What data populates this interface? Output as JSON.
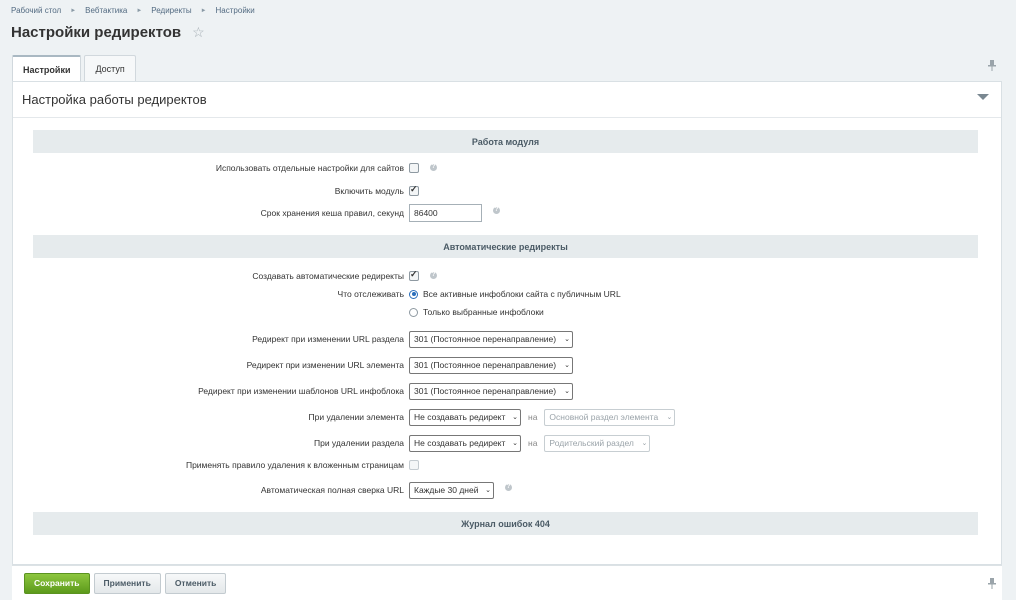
{
  "breadcrumbs": [
    "Рабочий стол",
    "Вебтактика",
    "Редиректы",
    "Настройки"
  ],
  "title": "Настройки редиректов",
  "tabs": [
    {
      "label": "Настройки",
      "active": true
    },
    {
      "label": "Доступ",
      "active": false
    }
  ],
  "panel_title": "Настройка работы редиректов",
  "sections": {
    "module": "Работа модуля",
    "auto": "Автоматические редиректы",
    "errors": "Журнал ошибок 404"
  },
  "fields": {
    "separate_sites": {
      "label": "Использовать отдельные настройки для сайтов",
      "checked": false
    },
    "enable_module": {
      "label": "Включить модуль",
      "checked": true
    },
    "cache_time": {
      "label": "Срок хранения кеша правил, секунд",
      "value": "86400"
    },
    "create_auto": {
      "label": "Создавать автоматические редиректы",
      "checked": true
    },
    "track": {
      "label": "Что отслеживать",
      "options": [
        "Все активные инфоблоки сайта с публичным URL",
        "Только выбранные инфоблоки"
      ],
      "selected": 0
    },
    "section_url": {
      "label": "Редирект при изменении URL раздела",
      "value": "301 (Постоянное перенаправление)"
    },
    "element_url": {
      "label": "Редирект при изменении URL элемента",
      "value": "301 (Постоянное перенаправление)"
    },
    "iblock_templates": {
      "label": "Редирект при изменении шаблонов URL инфоблока",
      "value": "301 (Постоянное перенаправление)"
    },
    "delete_element": {
      "label": "При удалении элемента",
      "value": "Не создавать редирект",
      "na": "на",
      "target": "Основной раздел элемента"
    },
    "delete_section": {
      "label": "При удалении раздела",
      "value": "Не создавать редирект",
      "na": "на",
      "target": "Родительский раздел"
    },
    "apply_nested": {
      "label": "Применять правило удаления к вложенным страницам",
      "checked": false
    },
    "full_check": {
      "label": "Автоматическая полная сверка URL",
      "value": "Каждые 30 дней"
    }
  },
  "footer": {
    "save": "Сохранить",
    "apply": "Применить",
    "cancel": "Отменить"
  },
  "icons": {
    "star": "star-icon",
    "pin": "pin-icon",
    "help": "help-icon",
    "collapse": "collapse-icon"
  },
  "colors": {
    "primary_button": "#6fae25",
    "section_bg": "#e6ebed",
    "page_bg": "#eef2f4"
  }
}
